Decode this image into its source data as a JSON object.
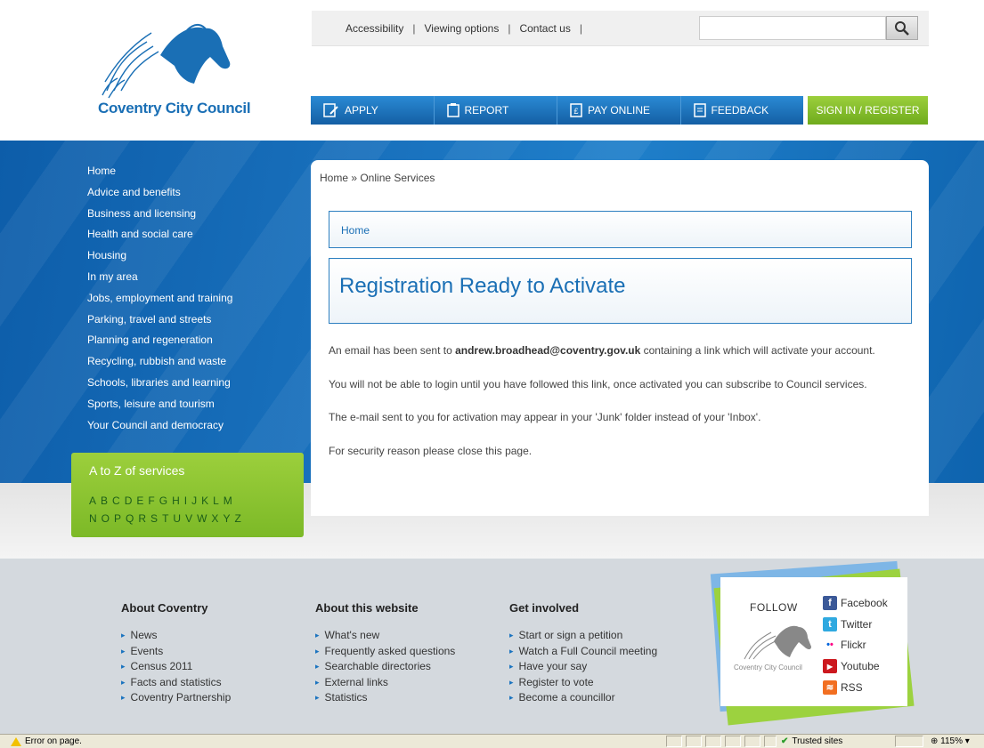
{
  "header": {
    "logo_text": "Coventry City Council",
    "util_links": [
      "Accessibility",
      "Viewing options",
      "Contact us"
    ],
    "search": {
      "value": "",
      "placeholder": ""
    },
    "nav": [
      {
        "label": "APPLY",
        "icon": "apply-icon"
      },
      {
        "label": "REPORT",
        "icon": "clipboard-icon"
      },
      {
        "label": "PAY ONLINE",
        "icon": "pay-icon"
      },
      {
        "label": "FEEDBACK",
        "icon": "document-icon"
      }
    ],
    "signin_label": "SIGN IN / REGISTER"
  },
  "sidebar": {
    "items": [
      "Home",
      "Advice and benefits",
      "Business and licensing",
      "Health and social care",
      "Housing",
      "In my area",
      "Jobs, employment and training",
      "Parking, travel and streets",
      "Planning and regeneration",
      "Recycling, rubbish and waste",
      "Schools, libraries and learning",
      "Sports, leisure and tourism",
      "Your Council and democracy"
    ],
    "atoz": {
      "title": "A to Z of services",
      "row1": [
        "A",
        "B",
        "C",
        "D",
        "E",
        "F",
        "G",
        "H",
        "I",
        "J",
        "K",
        "L",
        "M"
      ],
      "row2": [
        "N",
        "O",
        "P",
        "Q",
        "R",
        "S",
        "T",
        "U",
        "V",
        "W",
        "X",
        "Y",
        "Z"
      ]
    }
  },
  "main": {
    "breadcrumb": "Home » Online Services",
    "home_link": "Home",
    "title": "Registration Ready to Activate",
    "para1_pre": "An email has been sent to ",
    "para1_email": "andrew.broadhead@coventry.gov.uk",
    "para1_post": " containing a link which will activate your account.",
    "para2": "You will not be able to login until you have followed this link, once activated you can subscribe to Council services.",
    "para3": "The e-mail sent to you for activation may appear in your 'Junk' folder instead of your 'Inbox'.",
    "para4": "For security reason please close this page."
  },
  "footer": {
    "about_coventry": {
      "title": "About Coventry",
      "items": [
        "News",
        "Events",
        "Census 2011",
        "Facts and statistics",
        "Coventry Partnership"
      ]
    },
    "about_website": {
      "title": "About this website",
      "items": [
        "What's new",
        "Frequently asked questions",
        "Searchable directories",
        "External links",
        "Statistics"
      ]
    },
    "get_involved": {
      "title": "Get involved",
      "items": [
        "Start or sign a petition",
        "Watch a Full Council meeting",
        "Have your say",
        "Register to vote",
        "Become a councillor"
      ]
    },
    "follow": {
      "title": "FOLLOW",
      "logo_text": "Coventry City Council",
      "links": [
        {
          "label": "Facebook",
          "color": "#3b5998",
          "glyph": "f"
        },
        {
          "label": "Twitter",
          "color": "#2fa9e0",
          "glyph": "t"
        },
        {
          "label": "Flickr",
          "color": "#ffffff",
          "glyph": "••"
        },
        {
          "label": "Youtube",
          "color": "#cc181e",
          "glyph": "▶"
        },
        {
          "label": "RSS",
          "color": "#f26f21",
          "glyph": "≋"
        }
      ]
    }
  },
  "statusbar": {
    "error_text": "Error on page.",
    "zone_text": "Trusted sites",
    "zoom_text": "115%"
  },
  "colors": {
    "brand_blue": "#1a6fb5",
    "nav_blue": "#1f77c2",
    "accent_green": "#8cc43a"
  }
}
